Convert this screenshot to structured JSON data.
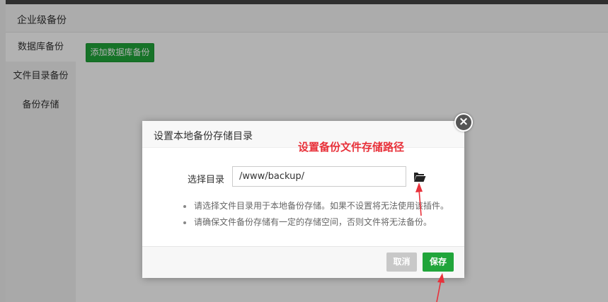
{
  "header": {
    "title": "企业级备份"
  },
  "sidebar": {
    "items": [
      {
        "label": "数据库备份",
        "active": true
      },
      {
        "label": "文件目录备份",
        "active": false
      },
      {
        "label": "备份存储",
        "active": false
      }
    ]
  },
  "content": {
    "add_button_label": "添加数据库备份"
  },
  "dialog": {
    "title": "设置本地备份存储目录",
    "field_label": "选择目录",
    "path_value": "/www/backup/",
    "folder_icon": "folder-open-icon",
    "close_icon": "close-icon",
    "tips": [
      "请选择文件目录用于本地备份存储。如果不设置将无法使用该插件。",
      "请确保文件备份存储有一定的存储空间，否则文件将无法备份。"
    ],
    "cancel_label": "取消",
    "save_label": "保存"
  },
  "annotation": {
    "text": "设置备份文件存储路径",
    "color": "#e8313a"
  },
  "colors": {
    "accent_green": "#20a53a",
    "cancel_gray": "#c8c8c8",
    "annotation_red": "#e8313a"
  }
}
